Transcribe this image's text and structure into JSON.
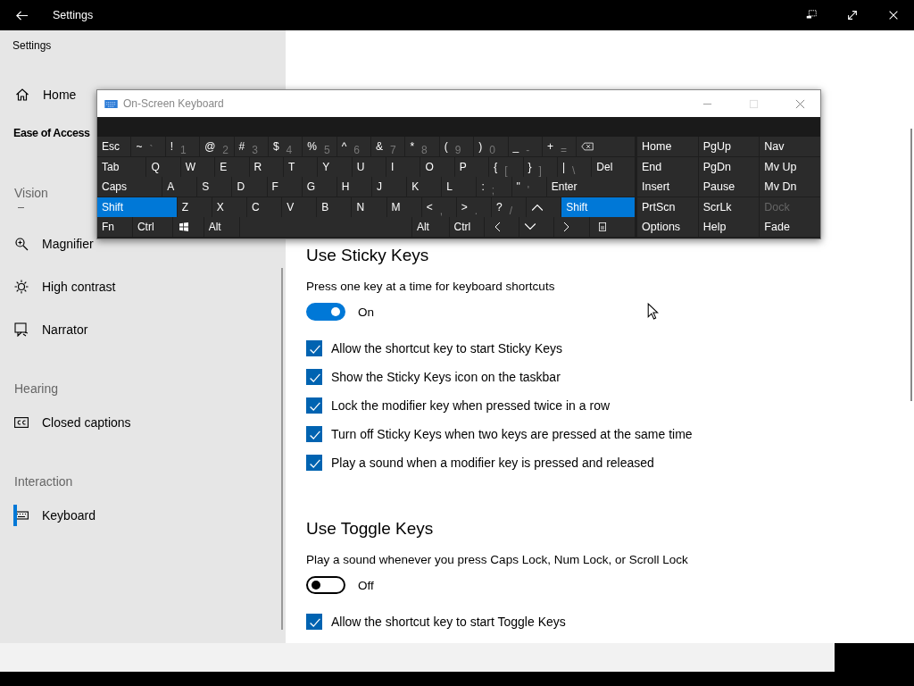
{
  "window": {
    "title": "Settings"
  },
  "sidebar": {
    "app_label": "Settings",
    "home": "Home",
    "category": "Ease of Access",
    "groups": [
      {
        "heading": "Vision",
        "items": [
          {
            "label": "Magnifier",
            "selected": false
          },
          {
            "label": "High contrast",
            "selected": false
          },
          {
            "label": "Narrator",
            "selected": false
          }
        ]
      },
      {
        "heading": "Hearing",
        "items": [
          {
            "label": "Closed captions",
            "selected": false
          }
        ]
      },
      {
        "heading": "Interaction",
        "items": [
          {
            "label": "Keyboard",
            "selected": true
          }
        ]
      }
    ]
  },
  "sections": [
    {
      "heading": "Use Sticky Keys",
      "description": "Press one key at a time for keyboard shortcuts",
      "toggle": {
        "on": true,
        "label": "On"
      },
      "options": [
        {
          "label": "Allow the shortcut key to start Sticky Keys",
          "checked": true
        },
        {
          "label": "Show the Sticky Keys icon on the taskbar",
          "checked": true
        },
        {
          "label": "Lock the modifier key when pressed twice in a row",
          "checked": true
        },
        {
          "label": "Turn off Sticky Keys when two keys are pressed at the same time",
          "checked": true
        },
        {
          "label": "Play a sound when a modifier key is pressed and released",
          "checked": true
        }
      ]
    },
    {
      "heading": "Use Toggle Keys",
      "description": "Play a sound whenever you press Caps Lock, Num Lock, or Scroll Lock",
      "toggle": {
        "on": false,
        "label": "Off"
      },
      "options": [
        {
          "label": "Allow the shortcut key to start Toggle Keys",
          "checked": true
        }
      ]
    }
  ],
  "osk": {
    "title": "On-Screen Keyboard",
    "rows": [
      {
        "keys": [
          {
            "label": "Esc",
            "selected": false
          },
          {
            "label": "~",
            "sub": "`",
            "selected": false
          },
          {
            "label": "!",
            "sub": "1",
            "selected": false
          },
          {
            "label": "@",
            "sub": "2",
            "selected": false
          },
          {
            "label": "#",
            "sub": "3",
            "selected": false
          },
          {
            "label": "$",
            "sub": "4",
            "selected": false
          },
          {
            "label": "%",
            "sub": "5",
            "selected": false
          },
          {
            "label": "^",
            "sub": "6",
            "selected": false
          },
          {
            "label": "&",
            "sub": "7",
            "selected": false
          },
          {
            "label": "*",
            "sub": "8",
            "selected": false
          },
          {
            "label": "(",
            "sub": "9",
            "selected": false
          },
          {
            "label": ")",
            "sub": "0",
            "selected": false
          },
          {
            "label": "_",
            "sub": "-",
            "selected": false
          },
          {
            "label": "+",
            "sub": "=",
            "selected": false
          },
          {
            "kind": "backspace",
            "selected": false
          }
        ]
      },
      {
        "keys": [
          {
            "label": "Tab",
            "selected": false
          },
          {
            "label": "Q",
            "selected": false
          },
          {
            "label": "W",
            "selected": false
          },
          {
            "label": "E",
            "selected": false
          },
          {
            "label": "R",
            "selected": false
          },
          {
            "label": "T",
            "selected": false
          },
          {
            "label": "Y",
            "selected": false
          },
          {
            "label": "U",
            "selected": false
          },
          {
            "label": "I",
            "selected": false
          },
          {
            "label": "O",
            "selected": false
          },
          {
            "label": "P",
            "selected": false
          },
          {
            "label": "{",
            "sub": "[",
            "selected": false
          },
          {
            "label": "}",
            "sub": "]",
            "selected": false
          },
          {
            "label": "|",
            "sub": "\\",
            "selected": false
          },
          {
            "label": "Del",
            "selected": false
          }
        ]
      },
      {
        "keys": [
          {
            "label": "Caps",
            "selected": false
          },
          {
            "label": "A",
            "selected": false
          },
          {
            "label": "S",
            "selected": false
          },
          {
            "label": "D",
            "selected": false
          },
          {
            "label": "F",
            "selected": false
          },
          {
            "label": "G",
            "selected": false
          },
          {
            "label": "H",
            "selected": false
          },
          {
            "label": "J",
            "selected": false
          },
          {
            "label": "K",
            "selected": false
          },
          {
            "label": "L",
            "selected": false
          },
          {
            "label": ":",
            "sub": ";",
            "selected": false
          },
          {
            "label": "\"",
            "sub": "'",
            "selected": false
          },
          {
            "label": "Enter",
            "selected": false
          }
        ]
      },
      {
        "keys": [
          {
            "label": "Shift",
            "selected": true
          },
          {
            "label": "Z",
            "selected": false
          },
          {
            "label": "X",
            "selected": false
          },
          {
            "label": "C",
            "selected": false
          },
          {
            "label": "V",
            "selected": false
          },
          {
            "label": "B",
            "selected": false
          },
          {
            "label": "N",
            "selected": false
          },
          {
            "label": "M",
            "selected": false
          },
          {
            "label": "<",
            "sub": ",",
            "selected": false
          },
          {
            "label": ">",
            "sub": ".",
            "selected": false
          },
          {
            "label": "?",
            "sub": "/",
            "selected": false
          },
          {
            "kind": "up",
            "selected": false
          },
          {
            "label": "Shift",
            "selected": true
          }
        ]
      },
      {
        "keys": [
          {
            "label": "Fn",
            "selected": false
          },
          {
            "label": "Ctrl",
            "selected": false
          },
          {
            "kind": "windows",
            "selected": false
          },
          {
            "label": "Alt",
            "selected": false
          },
          {
            "kind": "space",
            "selected": false
          },
          {
            "label": "Alt",
            "selected": false
          },
          {
            "label": "Ctrl",
            "selected": false
          },
          {
            "kind": "left",
            "selected": false
          },
          {
            "kind": "down",
            "selected": false
          },
          {
            "kind": "right",
            "selected": false
          },
          {
            "kind": "menu",
            "selected": false
          }
        ]
      }
    ],
    "nav_rows": [
      {
        "keys": [
          {
            "label": "Home",
            "disabled": false
          },
          {
            "label": "PgUp",
            "disabled": false
          },
          {
            "label": "Nav",
            "disabled": false
          }
        ]
      },
      {
        "keys": [
          {
            "label": "End",
            "disabled": false
          },
          {
            "label": "PgDn",
            "disabled": false
          },
          {
            "label": "Mv Up",
            "disabled": false
          }
        ]
      },
      {
        "keys": [
          {
            "label": "Insert",
            "disabled": false
          },
          {
            "label": "Pause",
            "disabled": false
          },
          {
            "label": "Mv Dn",
            "disabled": false
          }
        ]
      },
      {
        "keys": [
          {
            "label": "PrtScn",
            "disabled": false
          },
          {
            "label": "ScrLk",
            "disabled": false
          },
          {
            "label": "Dock",
            "disabled": true
          }
        ]
      },
      {
        "keys": [
          {
            "label": "Options",
            "disabled": false
          },
          {
            "label": "Help",
            "disabled": false
          },
          {
            "label": "Fade",
            "disabled": false
          }
        ]
      }
    ]
  }
}
